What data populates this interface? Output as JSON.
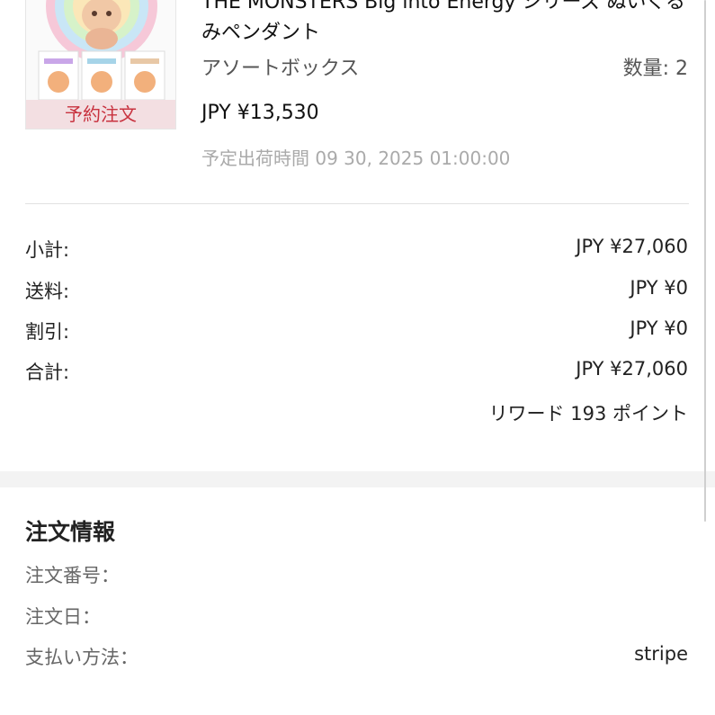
{
  "product": {
    "title": "THE MONSTERS Big into Energy シリーズ ぬいぐるみペンダント",
    "badge": "予約注文",
    "variant": "アソートボックス",
    "quantity": "数量: 2",
    "price": "JPY ¥13,530",
    "ship_date": "予定出荷時間 09 30, 2025 01:00:00"
  },
  "summary": {
    "subtotal_label": "小計:",
    "subtotal_value": "JPY ¥27,060",
    "shipping_label": "送料:",
    "shipping_value": "JPY ¥0",
    "discount_label": "割引:",
    "discount_value": "JPY ¥0",
    "total_label": "合計:",
    "total_value": "JPY ¥27,060",
    "reward": "リワード 193 ポイント"
  },
  "order_info": {
    "title": "注文情報",
    "number_label": "注文番号：",
    "number_value": "",
    "date_label": "注文日：",
    "date_value": "",
    "payment_label": "支払い方法：",
    "payment_value": "stripe"
  },
  "colors": {
    "badge_bg": "#f3dfe2",
    "badge_text": "#c8323f",
    "muted": "#aaaaaa"
  }
}
